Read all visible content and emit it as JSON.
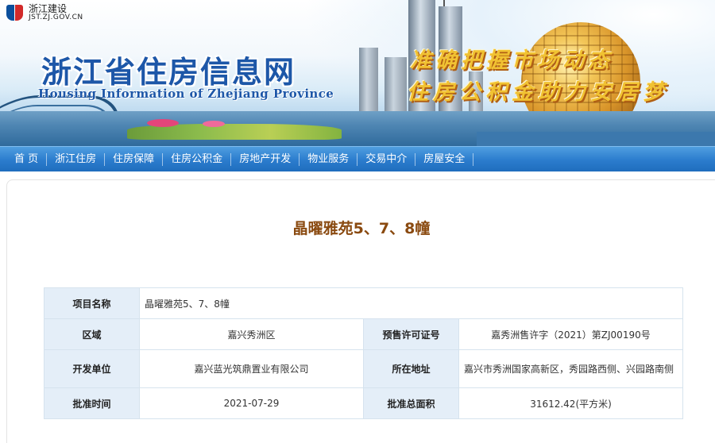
{
  "header": {
    "logo": {
      "cn": "浙江建设",
      "en": "JST.ZJ.GOV.CN"
    },
    "title": "浙江省住房信息网",
    "subtitle": "Housing Information of Zhejiang Province",
    "slogan_line1": "准确把握市场动态",
    "slogan_line2": "住房公积金助力安居梦"
  },
  "nav": {
    "items": [
      {
        "label": "首 页"
      },
      {
        "label": "浙江住房"
      },
      {
        "label": "住房保障"
      },
      {
        "label": "住房公积金"
      },
      {
        "label": "房地产开发"
      },
      {
        "label": "物业服务"
      },
      {
        "label": "交易中介"
      },
      {
        "label": "房屋安全"
      }
    ]
  },
  "page": {
    "title": "晶曜雅苑5、7、8幢"
  },
  "info": {
    "project_name": {
      "label": "项目名称",
      "value": "晶曜雅苑5、7、8幢"
    },
    "district": {
      "label": "区域",
      "value": "嘉兴秀洲区"
    },
    "presale_license": {
      "label": "预售许可证号",
      "value": "嘉秀洲售许字（2021）第ZJ00190号"
    },
    "developer": {
      "label": "开发单位",
      "value": "嘉兴蓝光筑鼎置业有限公司"
    },
    "address": {
      "label": "所在地址",
      "value": "嘉兴市秀洲国家高新区，秀园路西侧、兴园路南侧"
    },
    "approval_date": {
      "label": "批准时间",
      "value": "2021-07-29"
    },
    "approved_area": {
      "label": "批准总面积",
      "value": "31612.42(平方米)"
    }
  }
}
